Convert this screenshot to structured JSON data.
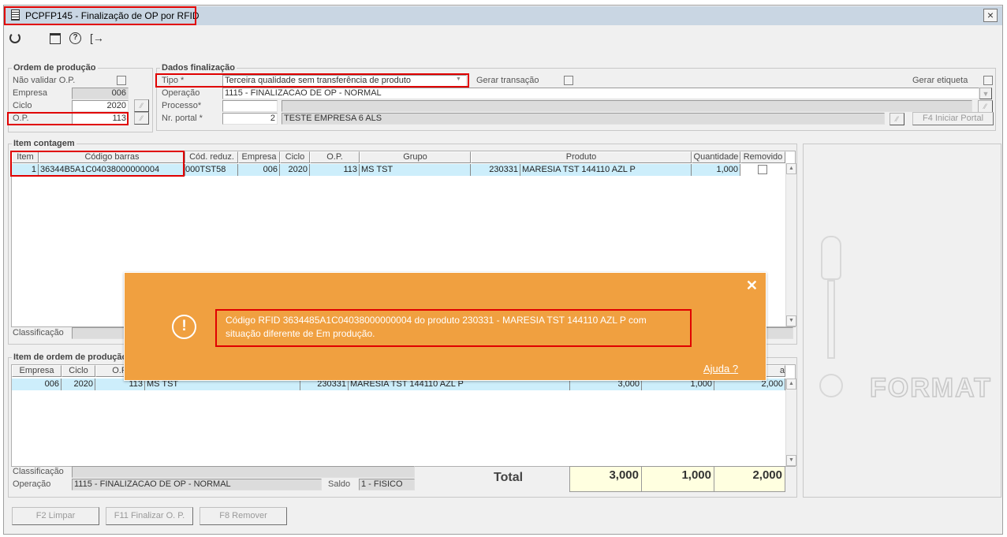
{
  "window": {
    "title": "PCPFP145 - Finalização de OP por RFID",
    "close": "×"
  },
  "toolbar": {
    "icons": [
      "refresh-icon",
      "calendar-icon",
      "help-icon",
      "exit-icon"
    ]
  },
  "ordem": {
    "title": "Ordem de produção",
    "nao_validar": "Não validar O.P.",
    "empresa_label": "Empresa",
    "empresa": "006",
    "ciclo_label": "Ciclo",
    "ciclo": "2020",
    "op_label": "O.P.",
    "op": "113"
  },
  "dados": {
    "title": "Dados finalização",
    "tipo_label": "Tipo *",
    "tipo": "Terceira qualidade sem transferência de produto",
    "gerar_transacao": "Gerar transação",
    "gerar_etiqueta": "Gerar etiqueta",
    "operacao_label": "Operação",
    "operacao": "1115 - FINALIZACAO DE OP - NORMAL",
    "processo_label": "Processo*",
    "processo": "",
    "processo_desc": "",
    "portal_label": "Nr. portal *",
    "portal": "2",
    "portal_desc": "TESTE EMPRESA 6 ALS",
    "iniciar_portal": "F4 Iniciar Portal"
  },
  "contagem": {
    "title": "Item contagem",
    "headers": [
      "Item",
      "Código barras",
      "Cód. reduz.",
      "Empresa",
      "Ciclo",
      "O.P.",
      "Grupo",
      "Produto",
      "Quantidade",
      "Removido"
    ],
    "rows": [
      {
        "item": "1",
        "codigo": "36344B5A1C04038000000004",
        "reduz": "000TST58",
        "empresa": "006",
        "ciclo": "2020",
        "op": "113",
        "grupo": "MS TST",
        "prod_ref": "230331",
        "prod_desc": "MARESIA TST 144110 AZL P",
        "qtd": "1,000",
        "removido": false
      }
    ],
    "classificacao_label": "Classificação"
  },
  "item_op": {
    "title": "Item de ordem de produção",
    "headers": [
      "Empresa",
      "Ciclo",
      "O.P.",
      "a"
    ],
    "rows": [
      {
        "empresa": "006",
        "ciclo": "2020",
        "op": "113",
        "grupo": "MS TST",
        "prod_ref": "230331",
        "prod_desc": "MARESIA TST 144110 AZL P",
        "v1": "3,000",
        "v2": "1,000",
        "v3": "2,000"
      }
    ],
    "classificacao_label": "Classificação",
    "operacao_label": "Operação",
    "operacao": "1115 - FINALIZACAO DE OP - NORMAL",
    "saldo_label": "Saldo",
    "saldo": "1 - FISICO",
    "total_label": "Total",
    "totals": [
      "3,000",
      "1,000",
      "2,000"
    ]
  },
  "logo": "FORMAT",
  "buttons": {
    "limpar": "F2 Limpar",
    "finalizar": "F11 Finalizar O. P.",
    "remover": "F8 Remover"
  },
  "dialog": {
    "message": "Código RFID 3634485A1C04038000000004 do produto 230331 - MARESIA TST 144110 AZL P com situação diferente de Em produção.",
    "help": "Ajuda ?",
    "close": "✕",
    "color": "#f0a040",
    "icon": "alert-circle-icon"
  }
}
